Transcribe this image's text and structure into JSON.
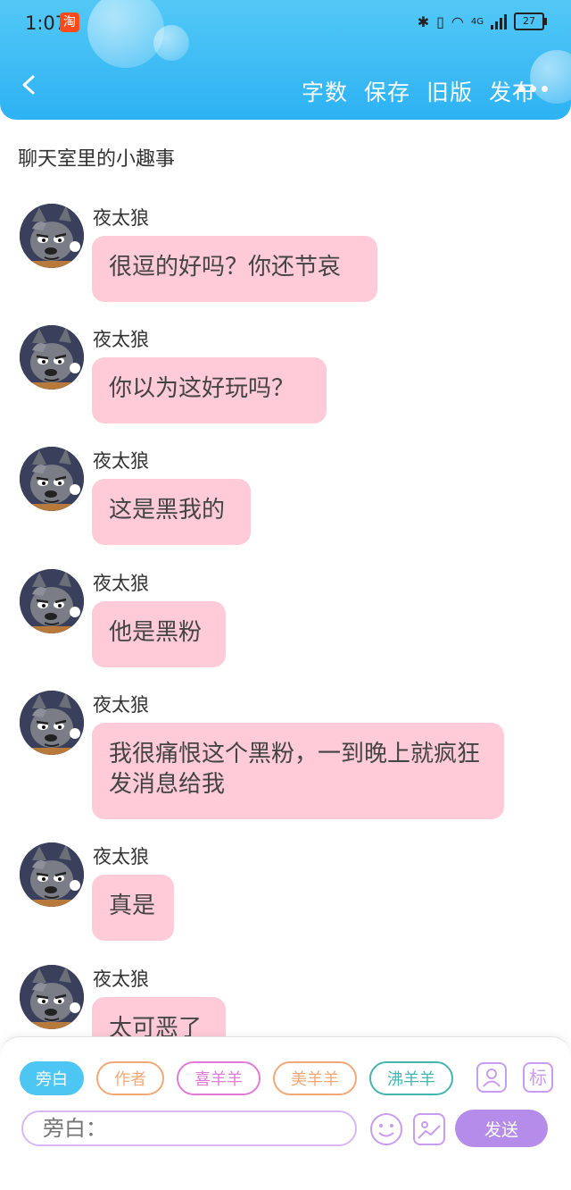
{
  "status": {
    "time": "1:07",
    "taobao": "淘",
    "network": "4G",
    "battery": "27"
  },
  "nav": {
    "word_count": "字数",
    "save": "保存",
    "old_version": "旧版",
    "publish": "发布"
  },
  "story_title": "聊天室里的小趣事",
  "messages": [
    {
      "speaker": "夜太狼",
      "text": "很逗的好吗？你还节哀"
    },
    {
      "speaker": "夜太狼",
      "text": "你以为这好玩吗？"
    },
    {
      "speaker": "夜太狼",
      "text": "这是黑我的"
    },
    {
      "speaker": "夜太狼",
      "text": "他是黑粉"
    },
    {
      "speaker": "夜太狼",
      "text": "我很痛恨这个黑粉，一到晚上就疯狂发消息给我"
    },
    {
      "speaker": "夜太狼",
      "text": "真是"
    },
    {
      "speaker": "夜太狼",
      "text": "太可恶了"
    }
  ],
  "roles": [
    {
      "label": "旁白",
      "color": "#4ec6f3"
    },
    {
      "label": "作者",
      "color": "#f2a977"
    },
    {
      "label": "喜羊羊",
      "color": "#e37ad8"
    },
    {
      "label": "美羊羊",
      "color": "#f2a977"
    },
    {
      "label": "沸羊羊",
      "color": "#45b5b0"
    }
  ],
  "tools": {
    "character_icon": "person-card-icon",
    "mark_label": "标"
  },
  "input": {
    "placeholder": "旁白："
  },
  "send_label": "发送",
  "colors": {
    "header": "#2db2f3",
    "bubble": "#ffcbd8",
    "accent": "#b58ce9"
  }
}
